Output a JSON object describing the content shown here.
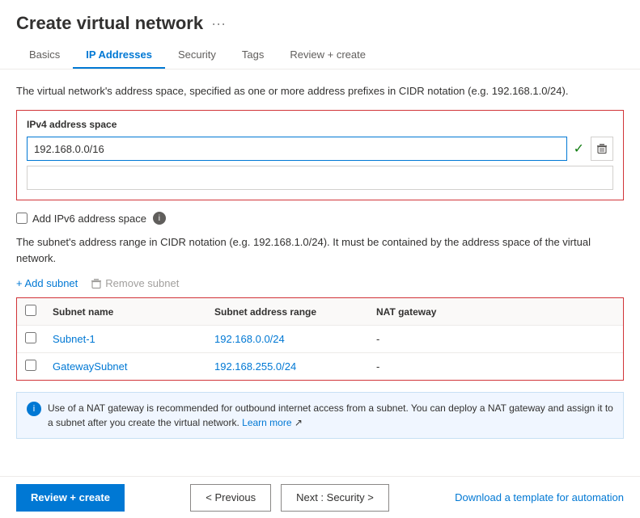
{
  "header": {
    "title": "Create virtual network",
    "dots_label": "···"
  },
  "tabs": [
    {
      "id": "basics",
      "label": "Basics",
      "active": false
    },
    {
      "id": "ip-addresses",
      "label": "IP Addresses",
      "active": true
    },
    {
      "id": "security",
      "label": "Security",
      "active": false
    },
    {
      "id": "tags",
      "label": "Tags",
      "active": false
    },
    {
      "id": "review-create",
      "label": "Review + create",
      "active": false
    }
  ],
  "description": "The virtual network's address space, specified as one or more address prefixes in CIDR notation (e.g. 192.168.1.0/24).",
  "ipv4_section": {
    "label": "IPv4 address space",
    "value": "192.168.0.0/16"
  },
  "ipv6_label": "Add IPv6 address space",
  "subnet_desc": "The subnet's address range in CIDR notation (e.g. 192.168.1.0/24). It must be contained by the address space of the virtual network.",
  "subnet_actions": {
    "add_label": "+ Add subnet",
    "remove_label": "Remove subnet"
  },
  "subnet_table": {
    "headers": [
      "",
      "Subnet name",
      "Subnet address range",
      "NAT gateway"
    ],
    "rows": [
      {
        "name": "Subnet-1",
        "range": "192.168.0.0/24",
        "nat": "-"
      },
      {
        "name": "GatewaySubnet",
        "range": "192.168.255.0/24",
        "nat": "-"
      }
    ]
  },
  "info_banner": "Use of a NAT gateway is recommended for outbound internet access from a subnet. You can deploy a NAT gateway and assign it to a subnet after you create the virtual network.",
  "info_link_label": "Learn more",
  "footer": {
    "review_create": "Review + create",
    "previous": "< Previous",
    "next": "Next : Security >",
    "download": "Download a template for automation"
  }
}
